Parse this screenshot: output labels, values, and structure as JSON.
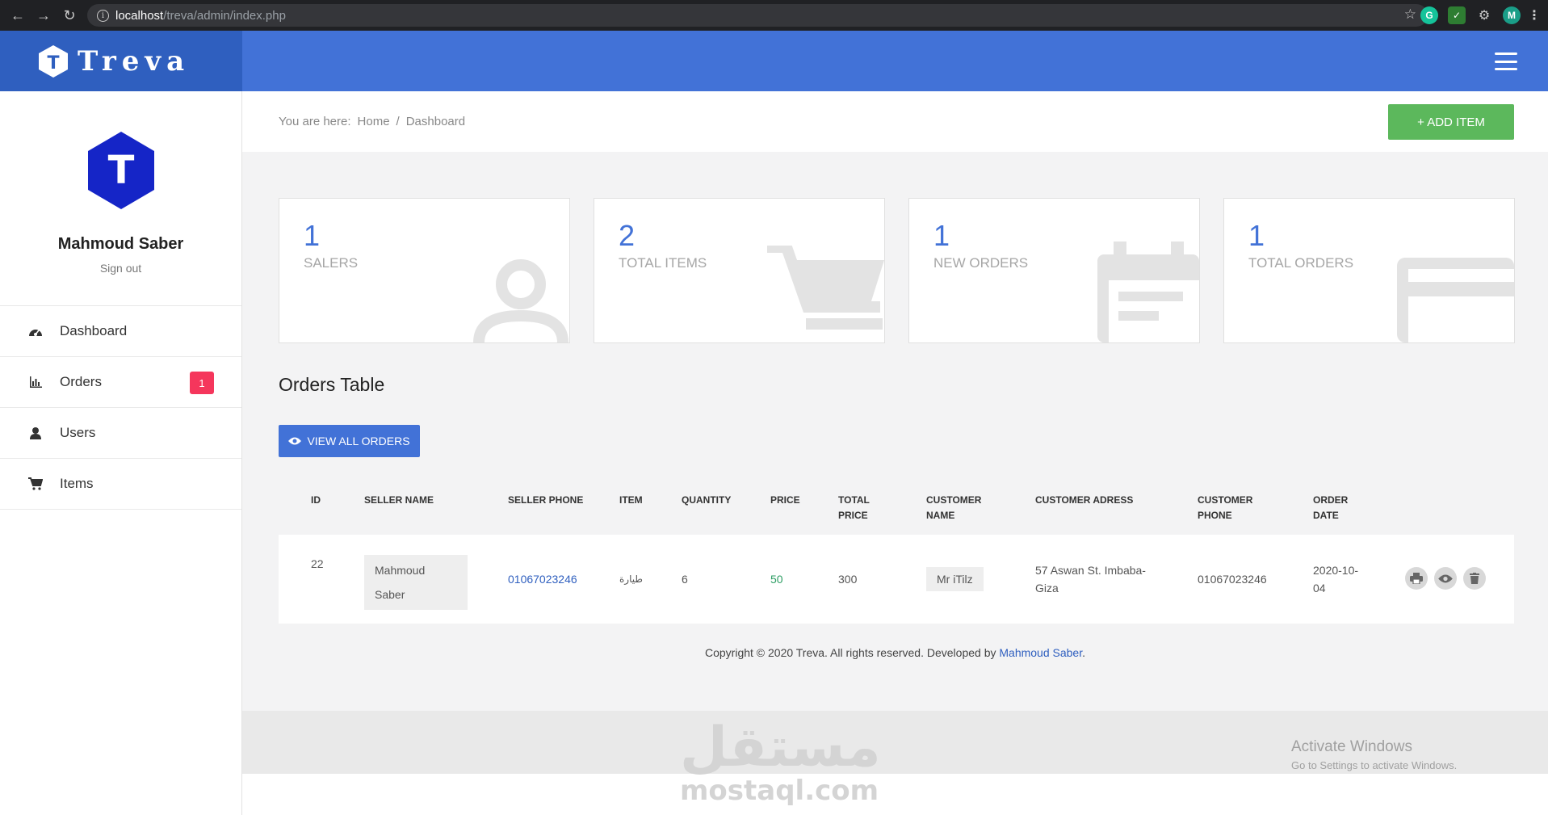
{
  "browser": {
    "url_host": "localhost",
    "url_path": "/treva/admin/index.php",
    "ext_g": "G",
    "ext_m": "M"
  },
  "brand": {
    "name": "Treva",
    "logo_letter": "T"
  },
  "profile": {
    "name": "Mahmoud Saber",
    "signout": "Sign out",
    "avatar_letter": "T"
  },
  "sidebar": {
    "items": [
      {
        "label": "Dashboard",
        "icon": "dashboard-icon"
      },
      {
        "label": "Orders",
        "icon": "bar-chart-icon",
        "badge": "1"
      },
      {
        "label": "Users",
        "icon": "user-icon"
      },
      {
        "label": "Items",
        "icon": "cart-icon"
      }
    ]
  },
  "breadcrumb": {
    "prefix": "You are here:",
    "home": "Home",
    "sep": "/",
    "current": "Dashboard"
  },
  "add_item_label": "+ ADD ITEM",
  "stats": [
    {
      "value": "1",
      "label": "SALERS",
      "icon": "user-icon"
    },
    {
      "value": "2",
      "label": "TOTAL ITEMS",
      "icon": "cart-icon"
    },
    {
      "value": "1",
      "label": "NEW ORDERS",
      "icon": "calendar-icon"
    },
    {
      "value": "1",
      "label": "TOTAL ORDERS",
      "icon": "credit-card-icon"
    }
  ],
  "orders": {
    "title": "Orders Table",
    "view_all_label": "VIEW ALL ORDERS",
    "headers": {
      "id": "ID",
      "seller_name": "SELLER NAME",
      "seller_phone": "SELLER PHONE",
      "item": "ITEM",
      "quantity": "QUANTITY",
      "price": "PRICE",
      "total_price_1": "TOTAL",
      "total_price_2": "PRICE",
      "customer_name_1": "CUSTOMER",
      "customer_name_2": "NAME",
      "customer_address": "CUSTOMER ADRESS",
      "customer_phone_1": "CUSTOMER",
      "customer_phone_2": "PHONE",
      "order_date_1": "ORDER",
      "order_date_2": "DATE"
    },
    "row": {
      "id": "22",
      "seller_name_1": "Mahmoud",
      "seller_name_2": "Saber",
      "seller_phone": "01067023246",
      "item": "طيارة",
      "quantity": "6",
      "price": "50",
      "total_price": "300",
      "customer_name": "Mr iTilz",
      "customer_address_1": "57 Aswan St. Imbaba-",
      "customer_address_2": "Giza",
      "customer_phone": "01067023246",
      "order_date_1": "2020-10-",
      "order_date_2": "04"
    }
  },
  "footer": {
    "text": "Copyright © 2020 Treva. All rights reserved. Developed by ",
    "author": "Mahmoud Saber",
    "end": "."
  },
  "watermark": {
    "arabic": "مستقل",
    "latin": "mostaql.com"
  },
  "activate": {
    "line1": "Activate Windows",
    "line2": "Go to Settings to activate Windows."
  },
  "colors": {
    "primary": "#4272d7",
    "brand_dark": "#2f5fbf",
    "success": "#5cb85c",
    "danger": "#f5365c"
  }
}
